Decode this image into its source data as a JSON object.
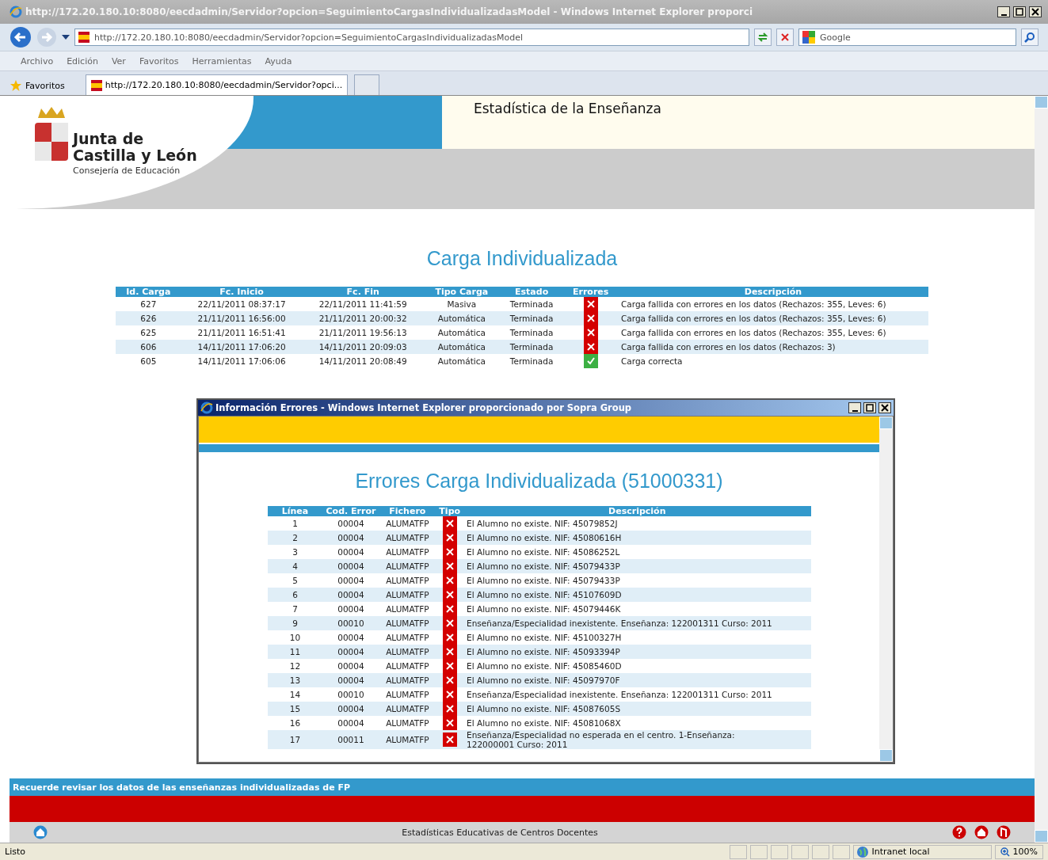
{
  "browser": {
    "title": "http://172.20.180.10:8080/eecdadmin/Servidor?opcion=SeguimientoCargasIndividualizadasModel - Windows Internet Explorer proporci",
    "address": "http://172.20.180.10:8080/eecdadmin/Servidor?opcion=SeguimientoCargasIndividualizadasModel",
    "search_placeholder": "Google",
    "menu": [
      "Archivo",
      "Edición",
      "Ver",
      "Favoritos",
      "Herramientas",
      "Ayuda"
    ],
    "favorites_label": "Favoritos",
    "tabs": [
      {
        "label": "http://172.20.180.10:8080/eecdadmin/Servidor?opci...",
        "selected": true
      }
    ]
  },
  "header": {
    "org_line1": "Junta de",
    "org_line2": "Castilla y León",
    "org_sub": "Consejería de Educación",
    "app_title": "Estadística de la Enseñanza"
  },
  "page_title": "Carga Individualizada",
  "loads_table": {
    "columns": [
      "Id. Carga",
      "Fc. Inicio",
      "Fc. Fin",
      "Tipo Carga",
      "Estado",
      "Errores",
      "Descripción"
    ],
    "rows": [
      {
        "id": "627",
        "start": "22/11/2011 08:37:17",
        "end": "22/11/2011 11:41:59",
        "type": "Masiva",
        "state": "Terminada",
        "ok": false,
        "description": "Carga fallida con errores en los datos (Rechazos: 355, Leves: 6)"
      },
      {
        "id": "626",
        "start": "21/11/2011 16:56:00",
        "end": "21/11/2011 20:00:32",
        "type": "Automática",
        "state": "Terminada",
        "ok": false,
        "description": "Carga fallida con errores en los datos (Rechazos: 355, Leves: 6)"
      },
      {
        "id": "625",
        "start": "21/11/2011 16:51:41",
        "end": "21/11/2011 19:56:13",
        "type": "Automática",
        "state": "Terminada",
        "ok": false,
        "description": "Carga fallida con errores en los datos (Rechazos: 355, Leves: 6)"
      },
      {
        "id": "606",
        "start": "14/11/2011 17:06:20",
        "end": "14/11/2011 20:09:03",
        "type": "Automática",
        "state": "Terminada",
        "ok": false,
        "description": "Carga fallida con errores en los datos (Rechazos: 3)"
      },
      {
        "id": "605",
        "start": "14/11/2011 17:06:06",
        "end": "14/11/2011 20:08:49",
        "type": "Automática",
        "state": "Terminada",
        "ok": true,
        "description": "Carga correcta"
      }
    ]
  },
  "popup": {
    "title": "Información Errores - Windows Internet Explorer proporcionado por Sopra Group",
    "heading": "Errores Carga Individualizada (51000331)",
    "table": {
      "columns": [
        "Línea",
        "Cod. Error",
        "Fichero",
        "Tipo",
        "Descripción"
      ],
      "rows": [
        {
          "line": "1",
          "code": "00004",
          "file": "ALUMATFP",
          "ok": false,
          "description": "El Alumno no existe. NIF: 45079852J"
        },
        {
          "line": "2",
          "code": "00004",
          "file": "ALUMATFP",
          "ok": false,
          "description": "El Alumno no existe. NIF: 45080616H"
        },
        {
          "line": "3",
          "code": "00004",
          "file": "ALUMATFP",
          "ok": false,
          "description": "El Alumno no existe. NIF: 45086252L"
        },
        {
          "line": "4",
          "code": "00004",
          "file": "ALUMATFP",
          "ok": false,
          "description": "El Alumno no existe. NIF: 45079433P"
        },
        {
          "line": "5",
          "code": "00004",
          "file": "ALUMATFP",
          "ok": false,
          "description": "El Alumno no existe. NIF: 45079433P"
        },
        {
          "line": "6",
          "code": "00004",
          "file": "ALUMATFP",
          "ok": false,
          "description": "El Alumno no existe. NIF: 45107609D"
        },
        {
          "line": "7",
          "code": "00004",
          "file": "ALUMATFP",
          "ok": false,
          "description": "El Alumno no existe. NIF: 45079446K"
        },
        {
          "line": "9",
          "code": "00010",
          "file": "ALUMATFP",
          "ok": false,
          "description": "Enseñanza/Especialidad inexistente. Enseñanza: 122001311 Curso: 2011"
        },
        {
          "line": "10",
          "code": "00004",
          "file": "ALUMATFP",
          "ok": false,
          "description": "El Alumno no existe. NIF: 45100327H"
        },
        {
          "line": "11",
          "code": "00004",
          "file": "ALUMATFP",
          "ok": false,
          "description": "El Alumno no existe. NIF: 45093394P"
        },
        {
          "line": "12",
          "code": "00004",
          "file": "ALUMATFP",
          "ok": false,
          "description": "El Alumno no existe. NIF: 45085460D"
        },
        {
          "line": "13",
          "code": "00004",
          "file": "ALUMATFP",
          "ok": false,
          "description": "El Alumno no existe. NIF: 45097970F"
        },
        {
          "line": "14",
          "code": "00010",
          "file": "ALUMATFP",
          "ok": false,
          "description": "Enseñanza/Especialidad inexistente. Enseñanza: 122001311 Curso: 2011"
        },
        {
          "line": "15",
          "code": "00004",
          "file": "ALUMATFP",
          "ok": false,
          "description": "El Alumno no existe. NIF: 45087605S"
        },
        {
          "line": "16",
          "code": "00004",
          "file": "ALUMATFP",
          "ok": false,
          "description": "El Alumno no existe. NIF: 45081068X"
        },
        {
          "line": "17",
          "code": "00011",
          "file": "ALUMATFP",
          "ok": false,
          "description": "Enseñanza/Especialidad no esperada en el centro. 1-Enseñanza: 122000001 Curso: 2011"
        }
      ]
    }
  },
  "notice": "Recuerde revisar los datos de las enseñanzas individualizadas de FP",
  "footer": {
    "text": "Estadísticas Educativas de Centros Docentes"
  },
  "status_bar": {
    "text": "Listo",
    "zone": "Intranet local",
    "zoom": "100%"
  }
}
